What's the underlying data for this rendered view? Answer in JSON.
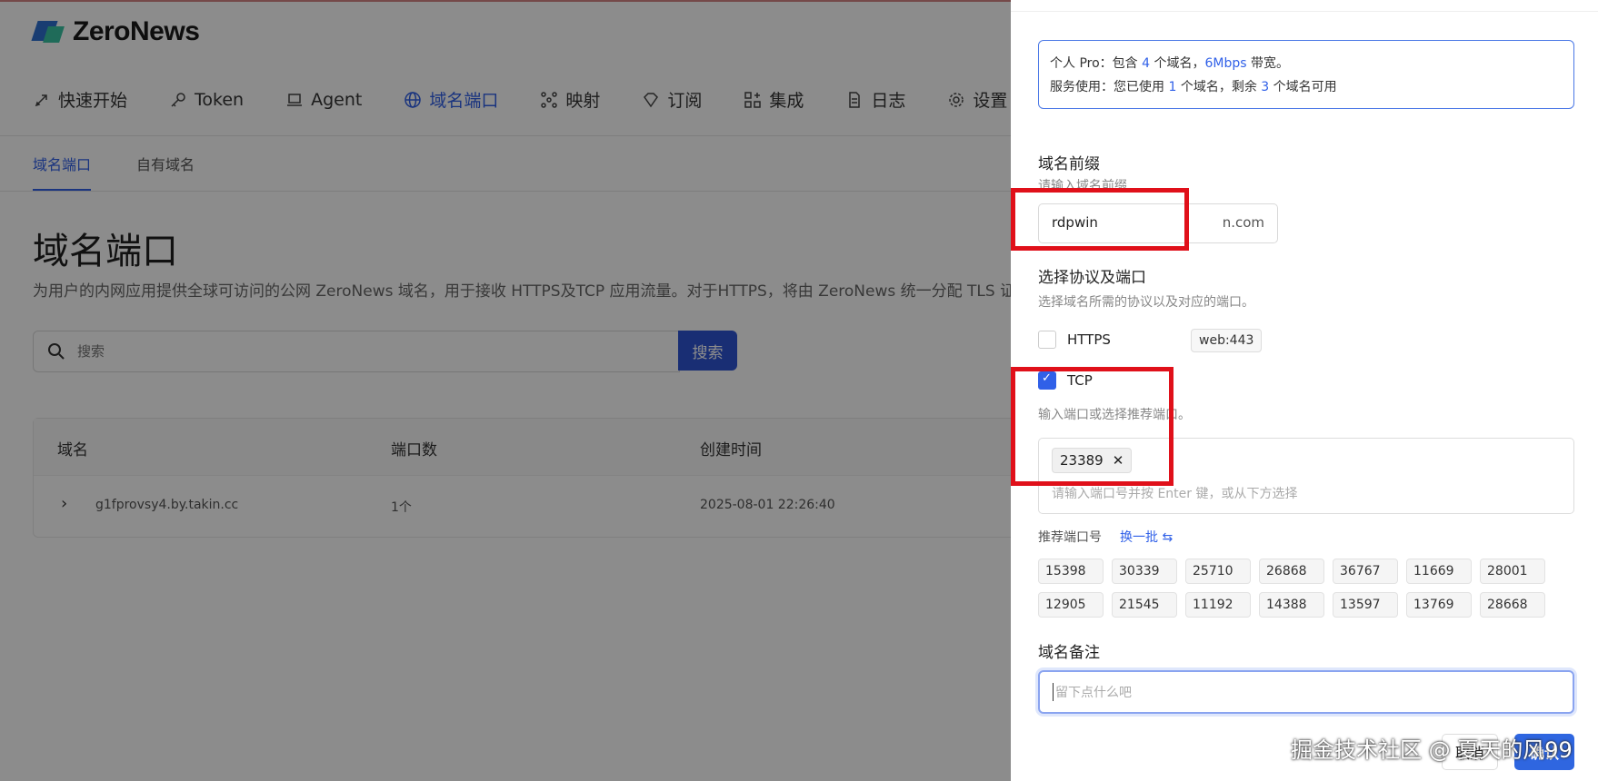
{
  "app": {
    "logo_text": "ZeroNews"
  },
  "nav": [
    {
      "label": "快速开始",
      "icon": "rocket-icon"
    },
    {
      "label": "Token",
      "icon": "key-icon"
    },
    {
      "label": "Agent",
      "icon": "laptop-icon"
    },
    {
      "label": "域名端口",
      "icon": "globe-icon",
      "active": true
    },
    {
      "label": "映射",
      "icon": "network-icon"
    },
    {
      "label": "订阅",
      "icon": "diamond-icon"
    },
    {
      "label": "集成",
      "icon": "grid-plus-icon"
    },
    {
      "label": "日志",
      "icon": "document-icon"
    },
    {
      "label": "设置",
      "icon": "gear-icon"
    }
  ],
  "subtabs": [
    {
      "label": "域名端口",
      "active": true
    },
    {
      "label": "自有域名"
    }
  ],
  "page": {
    "title": "域名端口",
    "description": "为用户的内网应用提供全球可访问的公网 ZeroNews 域名，用于接收 HTTPS及TCP 应用流量。对于HTTPS，将由 ZeroNews 统一分配 TLS 证书"
  },
  "search": {
    "placeholder": "搜索",
    "button": "搜索"
  },
  "table": {
    "headers": [
      "域名",
      "端口数",
      "创建时间"
    ],
    "rows": [
      {
        "domain": "g1fprovsy4.by.takin.cc",
        "ports": "1个",
        "created": "2025-08-01 22:26:40"
      }
    ]
  },
  "drawer": {
    "quota_line1_prefix": "个人 Pro：包含 ",
    "quota_domains": "4",
    "quota_line1_mid": " 个域名，",
    "quota_bandwidth": "6Mbps",
    "quota_line1_suffix": " 带宽。",
    "quota_line2_prefix": "服务使用：您已使用 ",
    "quota_used": "1",
    "quota_line2_mid": " 个域名，剩余 ",
    "quota_left": "3",
    "quota_line2_suffix": " 个域名可用",
    "prefix_label": "域名前缀",
    "prefix_hint": "请输入域名前缀",
    "prefix_value": "rdpwin",
    "prefix_suffix": "n.com",
    "protocol_label": "选择协议及端口",
    "protocol_hint": "选择域名所需的协议以及对应的端口。",
    "https_label": "HTTPS",
    "https_checked": false,
    "https_port": "web:443",
    "tcp_label": "TCP",
    "tcp_checked": true,
    "port_hint": "输入端口或选择推荐端口。",
    "selected_port": "23389",
    "port_placeholder": "请输入端口号并按 Enter 键，或从下方选择",
    "recommend_label": "推荐端口号",
    "recommend_refresh": "换一批 ⇆",
    "recommended_ports": [
      "15398",
      "30339",
      "25710",
      "26868",
      "36767",
      "11669",
      "28001",
      "12905",
      "21545",
      "11192",
      "14388",
      "13597",
      "13769",
      "28668"
    ],
    "note_label": "域名备注",
    "note_placeholder": "留下点什么吧",
    "cancel": "取消",
    "confirm": "确认"
  },
  "watermark": "掘金技术社区 @ 夏天的风99"
}
